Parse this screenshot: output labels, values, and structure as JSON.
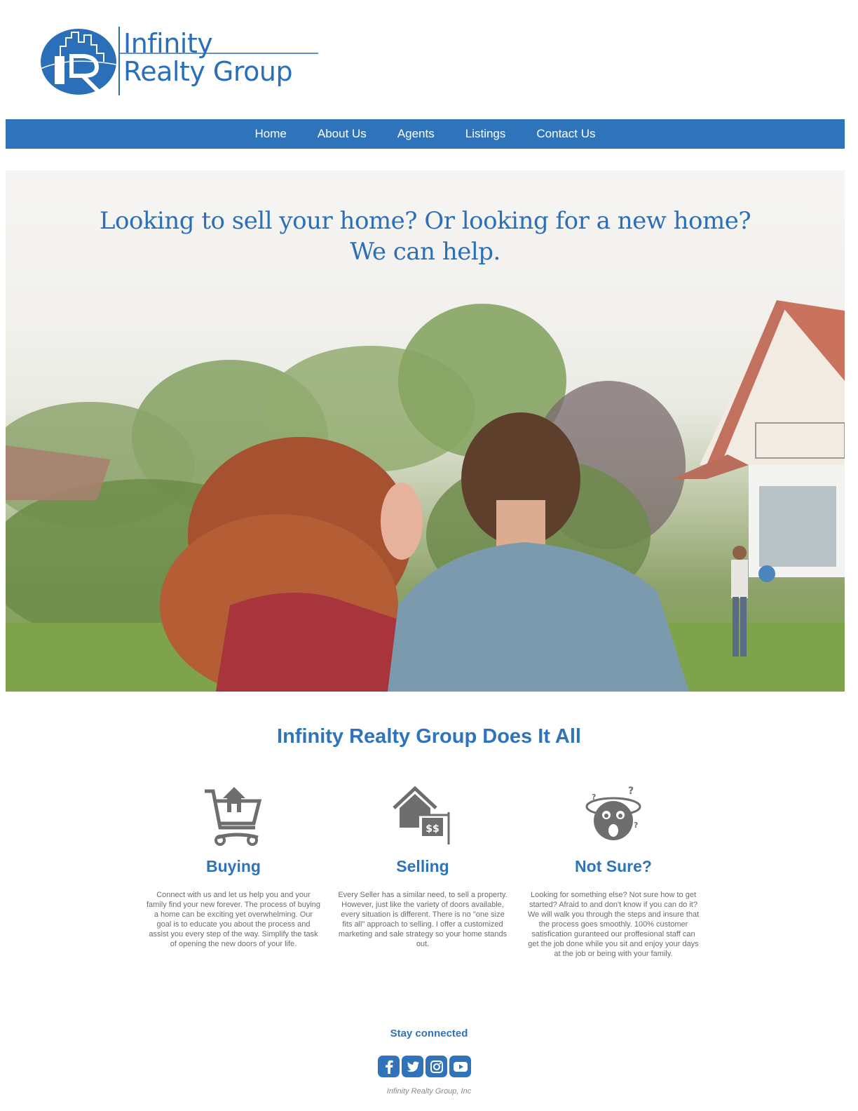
{
  "brand": {
    "name_line1": "Infinity",
    "name_line2": "Realty Group",
    "primary_color": "#2f73ba"
  },
  "nav": {
    "items": [
      "Home",
      "About Us",
      "Agents",
      "Listings",
      "Contact Us"
    ]
  },
  "hero": {
    "line1": "Looking to sell your home? Or looking for a new home?",
    "line2": "We can help."
  },
  "section": {
    "heading": "Infinity Realty Group Does It All"
  },
  "features": [
    {
      "icon": "shopping-cart-house-icon",
      "title": "Buying",
      "text": "Connect with us and let us help you and your family find your new forever. The process of buying a home can be exciting yet overwhelming. Our goal is to educate you about the process and assist you every step of the way. Simplify the task of opening the new doors of your life."
    },
    {
      "icon": "house-for-sale-sign-icon",
      "title": "Selling",
      "text": "Every Seller has a similar need, to sell a property. However, just like the variety of doors available, every situation is different. There is no \"one size fits all\" approach to selling. I offer a customized marketing and sale strategy so your home stands out."
    },
    {
      "icon": "confused-face-icon",
      "title": "Not Sure?",
      "text": "Looking for something else? Not sure how to get started? Afraid to and don't know if you can do it? We will walk you through the steps and insure that the process goes smoothly. 100% customer satisfication guranteed our proffesional staff can get the job done while you sit and enjoy your days at the job or being with your family."
    }
  ],
  "footer": {
    "stay_connected": "Stay connected",
    "social": [
      "facebook-icon",
      "twitter-icon",
      "instagram-icon",
      "youtube-icon"
    ],
    "copyright": "Infinity Realty Group, Inc"
  }
}
